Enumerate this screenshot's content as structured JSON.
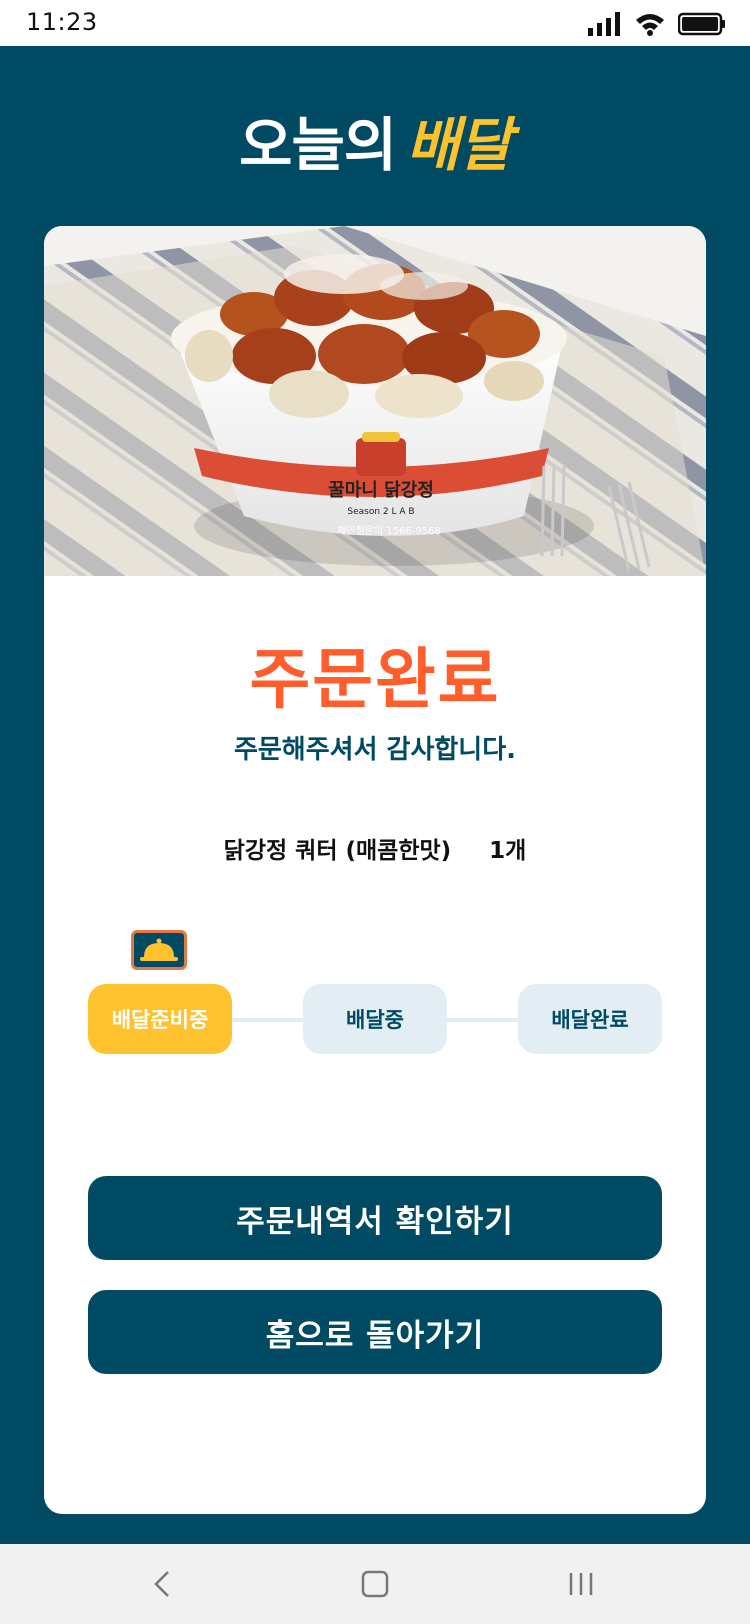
{
  "status_bar": {
    "time": "11:23"
  },
  "header": {
    "logo_part1": "오늘의",
    "logo_part2": "배달"
  },
  "order": {
    "title": "주문완료",
    "subtitle": "주문해주셔서 감사합니다.",
    "item_name": "닭강정 쿼터 (매콤한맛)",
    "item_qty": "1개"
  },
  "photo": {
    "brand_text": "꿀마니 닭강정",
    "brand_sub": "Season 2 L A B",
    "brand_phone": "체인점문의 1566-9568"
  },
  "tracker": {
    "steps": [
      "배달준비중",
      "배달중",
      "배달완료"
    ],
    "active_index": 0
  },
  "buttons": {
    "receipt": "주문내역서 확인하기",
    "home": "홈으로 돌아가기"
  },
  "colors": {
    "primary": "#004A63",
    "accent_yellow": "#FFC22F",
    "accent_orange": "#FF5E2C",
    "step_inactive": "#E2EEF4"
  },
  "icons": {
    "status": [
      "signal-icon",
      "wifi-icon",
      "battery-icon"
    ],
    "nav": [
      "back-icon",
      "home-icon",
      "recent-apps-icon"
    ],
    "tracker": "cloche-icon"
  }
}
